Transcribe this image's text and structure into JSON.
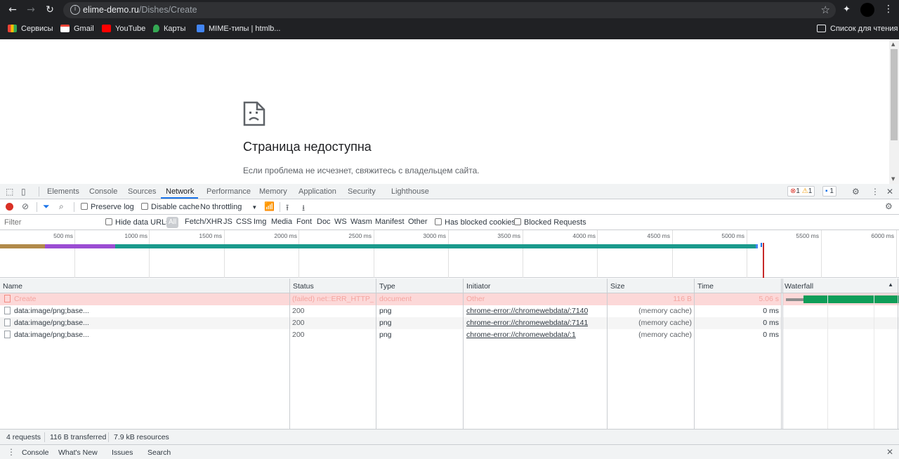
{
  "browser": {
    "url_host": "elime-demo.ru",
    "url_path": "/Dishes/Create",
    "bookmarks": [
      {
        "label": "Сервисы",
        "color": "#ea4335"
      },
      {
        "label": "Gmail",
        "color": "#ea4335"
      },
      {
        "label": "YouTube",
        "color": "#ff0000"
      },
      {
        "label": "Карты",
        "color": "#34a853"
      },
      {
        "label": "MIME-типы | htmlb...",
        "color": "#4285f4"
      }
    ],
    "reading_list": "Список для чтения"
  },
  "page": {
    "error_title": "Страница недоступна",
    "error_desc": "Если проблема не исчезнет, свяжитесь с владельцем сайта."
  },
  "devtools": {
    "tabs": [
      "Elements",
      "Console",
      "Sources",
      "Network",
      "Performance",
      "Memory",
      "Application",
      "Security",
      "Lighthouse"
    ],
    "active_tab": "Network",
    "errors": "1",
    "warnings": "1",
    "messages": "1",
    "toolbar": {
      "preserve_log": "Preserve log",
      "disable_cache": "Disable cache",
      "throttling": "No throttling"
    },
    "filterbar": {
      "placeholder": "Filter",
      "hide_data_urls": "Hide data URLs",
      "all": "All",
      "types": [
        "Fetch/XHR",
        "JS",
        "CSS",
        "Img",
        "Media",
        "Font",
        "Doc",
        "WS",
        "Wasm",
        "Manifest",
        "Other"
      ],
      "has_blocked_cookies": "Has blocked cookies",
      "blocked_requests": "Blocked Requests"
    },
    "overview_ticks": [
      "500 ms",
      "1000 ms",
      "1500 ms",
      "2000 ms",
      "2500 ms",
      "3000 ms",
      "3500 ms",
      "4000 ms",
      "4500 ms",
      "5000 ms",
      "5500 ms",
      "6000 ms"
    ],
    "columns": [
      "Name",
      "Status",
      "Type",
      "Initiator",
      "Size",
      "Time",
      "Waterfall"
    ],
    "rows": [
      {
        "name": "Create",
        "status": "(failed) net::ERR_HTTP_R...",
        "type": "document",
        "initiator": "Other",
        "size": "116 B",
        "time": "5.06 s"
      },
      {
        "name": "data:image/png;base...",
        "status": "200",
        "type": "png",
        "initiator": "chrome-error://chromewebdata/:7140",
        "size": "(memory cache)",
        "time": "0 ms"
      },
      {
        "name": "data:image/png;base...",
        "status": "200",
        "type": "png",
        "initiator": "chrome-error://chromewebdata/:7141",
        "size": "(memory cache)",
        "time": "0 ms"
      },
      {
        "name": "data:image/png;base...",
        "status": "200",
        "type": "png",
        "initiator": "chrome-error://chromewebdata/:1",
        "size": "(memory cache)",
        "time": "0 ms"
      }
    ],
    "status": {
      "requests": "4 requests",
      "transferred": "116 B transferred",
      "resources": "7.9 kB resources"
    },
    "drawer_tabs": [
      "Console",
      "What's New",
      "Issues",
      "Search"
    ]
  }
}
